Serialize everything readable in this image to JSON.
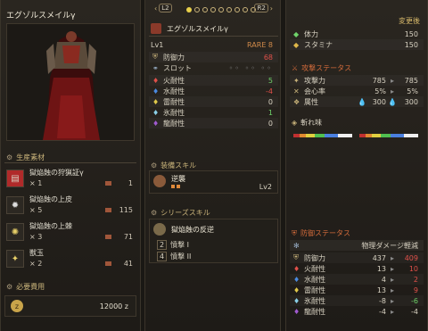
{
  "armor": {
    "name": "エグゾルスメイルγ",
    "level": "Lv1",
    "rarity": "RARE 8"
  },
  "header": {
    "left_button": "L2",
    "right_button": "R2"
  },
  "materials": {
    "header": "生産素材",
    "items": [
      {
        "name": "獄焔蝕の狩猟証γ",
        "need": "× 1",
        "have": "1"
      },
      {
        "name": "獄焔蝕の上皮",
        "need": "× 5",
        "have": "115"
      },
      {
        "name": "獄焔蝕の上棘",
        "need": "× 3",
        "have": "71"
      },
      {
        "name": "獣玉",
        "need": "× 2",
        "have": "41"
      }
    ]
  },
  "cost": {
    "header": "必要費用",
    "value": "12000 z"
  },
  "defense": {
    "label": "防御力",
    "value": "68",
    "slot_label": "スロット"
  },
  "resists": [
    {
      "label": "火耐性",
      "value": "5",
      "color": "#e0504a"
    },
    {
      "label": "水耐性",
      "value": "-4",
      "color": "#4a8ae0"
    },
    {
      "label": "雷耐性",
      "value": "0",
      "color": "#e0c84a"
    },
    {
      "label": "氷耐性",
      "value": "1",
      "color": "#8ad0e8"
    },
    {
      "label": "龍耐性",
      "value": "0",
      "color": "#a05ad0"
    }
  ],
  "equip_skill": {
    "header": "装備スキル",
    "name": "逆襲",
    "level": "Lv2"
  },
  "series_skill": {
    "header": "シリーズスキル",
    "name": "獄焔蝕の反逆",
    "items": [
      {
        "num": "2",
        "name": "憤撃 I"
      },
      {
        "num": "4",
        "name": "憤撃 II"
      }
    ]
  },
  "right": {
    "after_label": "変更後",
    "hp_label": "体力",
    "hp": "150",
    "stamina_label": "スタミナ",
    "stamina": "150",
    "attack_header": "攻撃ステータス",
    "attack_label": "攻撃力",
    "attack_before": "785",
    "attack_after": "785",
    "affinity_label": "会心率",
    "affinity_before": "5%",
    "affinity_after": "5%",
    "element_label": "属性",
    "element_before": "300",
    "element_after": "300",
    "sharpness_label": "斬れ味",
    "defense_header": "防御ステータス",
    "phys_label": "物理ダメージ軽減",
    "defense_rows": [
      {
        "label": "防御力",
        "before": "437",
        "after": "409",
        "color": "#e0504a"
      },
      {
        "label": "火耐性",
        "before": "13",
        "after": "10",
        "color": "#e0504a"
      },
      {
        "label": "水耐性",
        "before": "4",
        "after": "2",
        "color": "#e0504a"
      },
      {
        "label": "雷耐性",
        "before": "13",
        "after": "9",
        "color": "#e0504a"
      },
      {
        "label": "氷耐性",
        "before": "-8",
        "after": "-6",
        "color": "#6fd36a"
      },
      {
        "label": "龍耐性",
        "before": "-4",
        "after": "-4",
        "color": "#d8d2c2"
      }
    ]
  },
  "colors": {
    "accent_gold": "#c9b37a",
    "up_green": "#6fd36a",
    "down_red": "#e0504a"
  }
}
